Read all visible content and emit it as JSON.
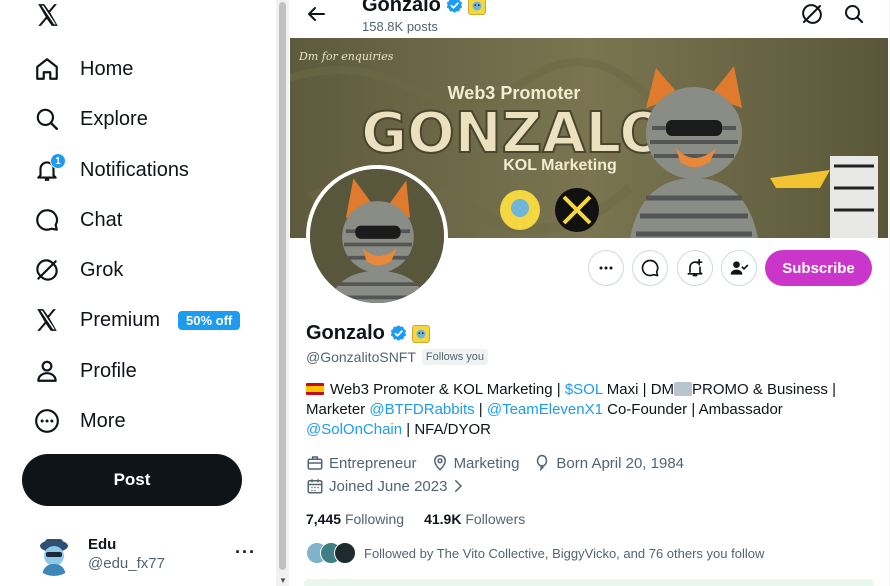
{
  "sidebar": {
    "items": [
      {
        "label": "Home",
        "icon": "home-icon"
      },
      {
        "label": "Explore",
        "icon": "search-icon"
      },
      {
        "label": "Notifications",
        "icon": "bell-icon",
        "badge": "1"
      },
      {
        "label": "Chat",
        "icon": "chat-icon"
      },
      {
        "label": "Grok",
        "icon": "grok-icon"
      },
      {
        "label": "Premium",
        "icon": "x-icon",
        "promo": "50% off"
      },
      {
        "label": "Profile",
        "icon": "person-icon"
      },
      {
        "label": "More",
        "icon": "more-circle-icon"
      }
    ],
    "post_label": "Post",
    "account": {
      "name": "Edu",
      "handle": "@edu_fx77",
      "more": "···"
    }
  },
  "header": {
    "title": "Gonzalo",
    "subtitle": "158.8K posts"
  },
  "banner": {
    "tagline": "Dm for enquiries",
    "title_top": "Web3 Promoter",
    "title_main": "GONZALO",
    "title_sub": "KOL Marketing"
  },
  "profile": {
    "name": "Gonzalo",
    "handle": "@GonzalitoSNFT",
    "follows_you": "Follows you",
    "subscribe_label": "Subscribe",
    "bio": {
      "line1_a": "Web3 Promoter & KOL Marketing | ",
      "line1_link": "$SOL",
      "line1_b": " Maxi | DM",
      "line1_c": "PROMO & Business |",
      "line2_a": "Marketer ",
      "line2_link1": "@BTFDRabbits",
      "line2_sep": " | ",
      "line2_link2": "@TeamElevenX1",
      "line2_b": " Co-Founder | Ambassador",
      "line3_link": "@SolOnChain",
      "line3_b": " | NFA/DYOR"
    },
    "category": "Entrepreneur",
    "location": "Marketing",
    "born": "Born April 20, 1984",
    "joined": "Joined June 2023",
    "following_count": "7,445",
    "following_label": "Following",
    "followers_count": "41.9K",
    "followers_label": "Followers",
    "followed_by": "Followed by The Vito Collective, BiggyVicko, and 76 others you follow"
  },
  "colors": {
    "accent": "#1d9bf0",
    "subscribe": "#c936c9",
    "text": "#0f1419",
    "muted": "#536471"
  }
}
